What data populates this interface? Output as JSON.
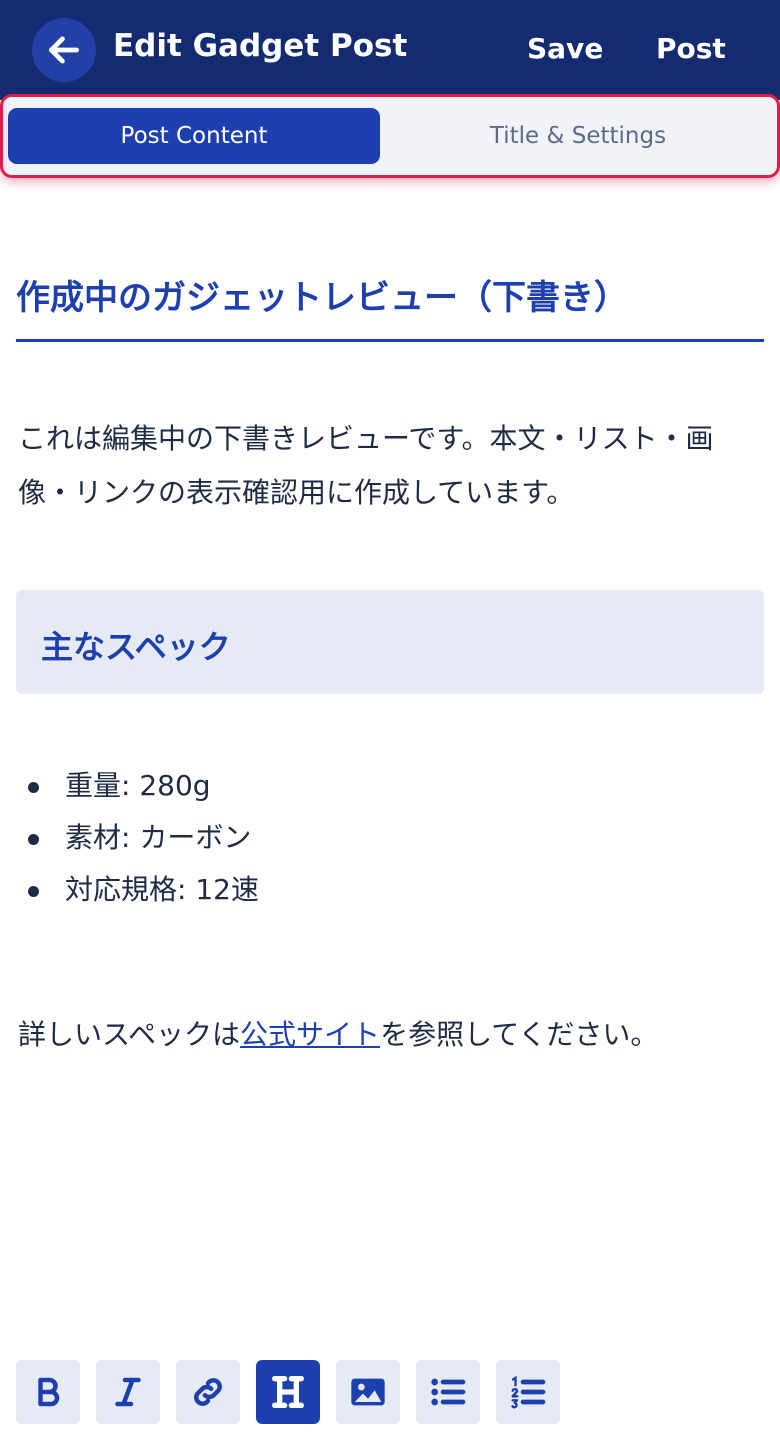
{
  "header": {
    "title": "Edit Gadget Post",
    "save_label": "Save",
    "post_label": "Post"
  },
  "tabs": [
    {
      "label": "Post Content",
      "active": true
    },
    {
      "label": "Title & Settings",
      "active": false
    }
  ],
  "content": {
    "heading": "作成中のガジェットレビュー（下書き）",
    "paragraph": "これは編集中の下書きレビューです。本文・リスト・画像・リンクの表示確認用に作成しています。",
    "subheading": "主なスペック",
    "specs": [
      "重量: 280g",
      "素材: カーボン",
      "対応規格: 12速"
    ],
    "ref_before": "詳しいスペックは",
    "ref_link": "公式サイト",
    "ref_after": "を参照してください。"
  },
  "toolbar": {
    "tools": [
      "bold-icon",
      "italic-icon",
      "link-icon",
      "heading-icon",
      "image-icon",
      "bullet-list-icon",
      "numbered-list-icon"
    ],
    "active_tool": "heading-icon"
  },
  "colors": {
    "header_bg": "#142b72",
    "accent": "#1e40af",
    "highlight_border": "#e11d48",
    "soft_bg": "#e6eaf4"
  }
}
